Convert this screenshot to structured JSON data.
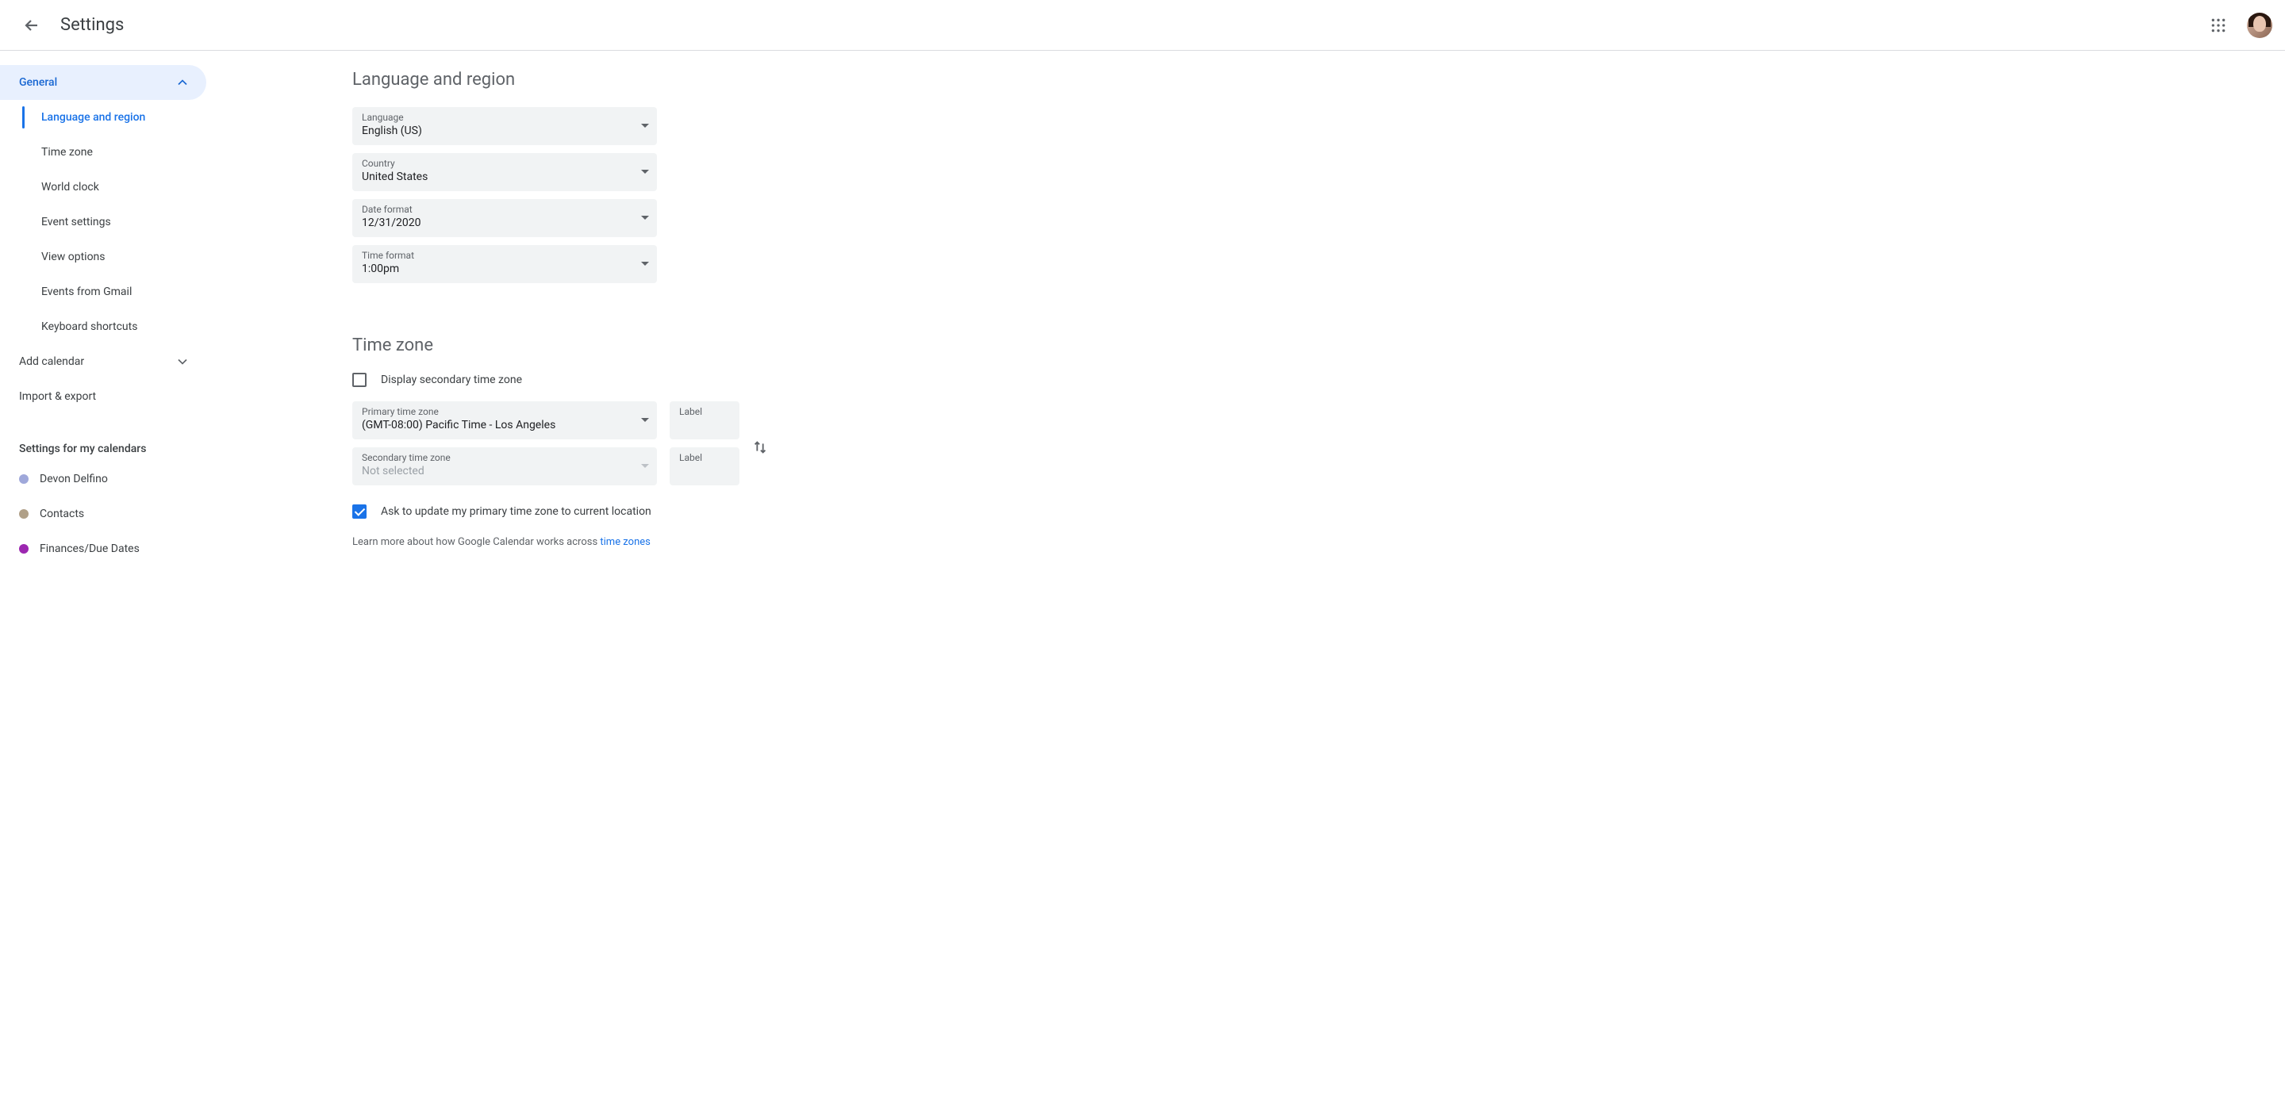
{
  "header": {
    "title": "Settings"
  },
  "sidebar": {
    "general_label": "General",
    "sub": {
      "language_region": "Language and region",
      "time_zone": "Time zone",
      "world_clock": "World clock",
      "event_settings": "Event settings",
      "view_options": "View options",
      "events_from_gmail": "Events from Gmail",
      "keyboard_shortcuts": "Keyboard shortcuts"
    },
    "add_calendar": "Add calendar",
    "import_export": "Import & export",
    "my_calendars_label": "Settings for my calendars",
    "calendars": [
      {
        "name": "Devon Delfino",
        "color": "#9fa8da"
      },
      {
        "name": "Contacts",
        "color": "#b0a088"
      },
      {
        "name": "Finances/Due Dates",
        "color": "#9c27b0"
      }
    ]
  },
  "language_region": {
    "section_title": "Language and region",
    "language": {
      "label": "Language",
      "value": "English (US)"
    },
    "country": {
      "label": "Country",
      "value": "United States"
    },
    "date_format": {
      "label": "Date format",
      "value": "12/31/2020"
    },
    "time_format": {
      "label": "Time format",
      "value": "1:00pm"
    }
  },
  "time_zone": {
    "section_title": "Time zone",
    "display_secondary_label": "Display secondary time zone",
    "display_secondary_checked": false,
    "primary": {
      "label": "Primary time zone",
      "value": "(GMT-08:00) Pacific Time - Los Angeles"
    },
    "primary_label_field": "Label",
    "secondary": {
      "label": "Secondary time zone",
      "value": "Not selected"
    },
    "secondary_label_field": "Label",
    "ask_update_label": "Ask to update my primary time zone to current location",
    "ask_update_checked": true,
    "helper_text": "Learn more about how Google Calendar works across ",
    "helper_link": "time zones"
  }
}
